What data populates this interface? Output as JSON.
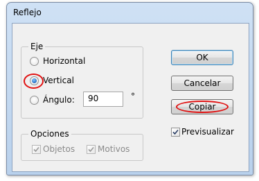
{
  "window": {
    "title": "Reflejo"
  },
  "eje": {
    "legend": "Eje",
    "options": [
      {
        "label": "Horizontal",
        "selected": false
      },
      {
        "label": "Vertical",
        "selected": true
      },
      {
        "label": "Ángulo:",
        "selected": false
      }
    ],
    "angle_value": "90",
    "degree_symbol": "°"
  },
  "opciones": {
    "legend": "Opciones",
    "objetos_label": "Objetos",
    "objetos_checked": true,
    "motivos_label": "Motivos",
    "motivos_checked": true
  },
  "buttons": {
    "ok": "OK",
    "cancel": "Cancelar",
    "copy": "Copiar"
  },
  "preview": {
    "label": "Previsualizar",
    "checked": true
  },
  "highlight_color": "#e01010",
  "icons": [
    "radio-icon",
    "checkbox-icon"
  ]
}
